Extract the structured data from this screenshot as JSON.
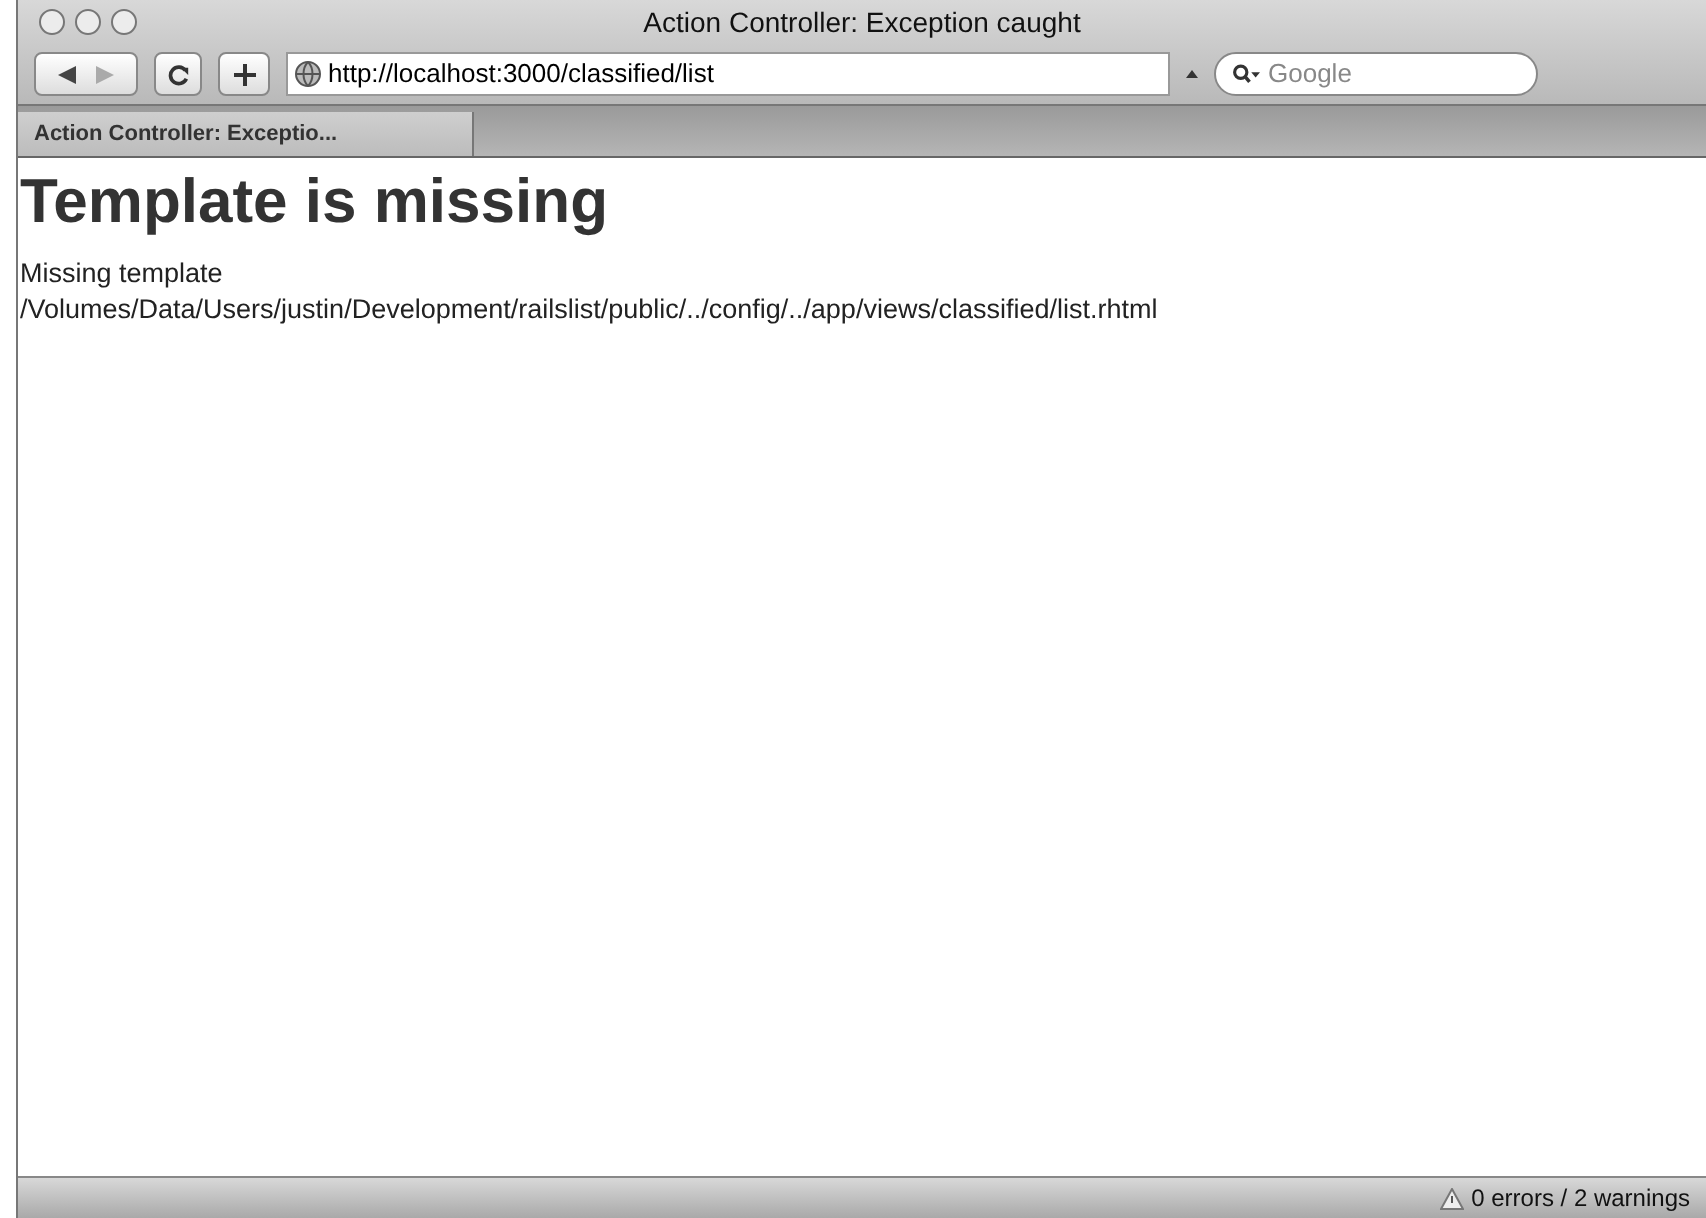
{
  "window": {
    "title": "Action Controller: Exception caught"
  },
  "toolbar": {
    "url": "http://localhost:3000/classified/list",
    "search": {
      "placeholder": "Google"
    }
  },
  "tabs": [
    {
      "label": "Action Controller: Exceptio...",
      "selected": true
    }
  ],
  "page": {
    "heading": "Template is missing",
    "lines": [
      "Missing template",
      "/Volumes/Data/Users/justin/Development/railslist/public/../config/../app/views/classified/list.rhtml"
    ]
  },
  "status_bar": {
    "text": "0 errors / 2 warnings"
  }
}
